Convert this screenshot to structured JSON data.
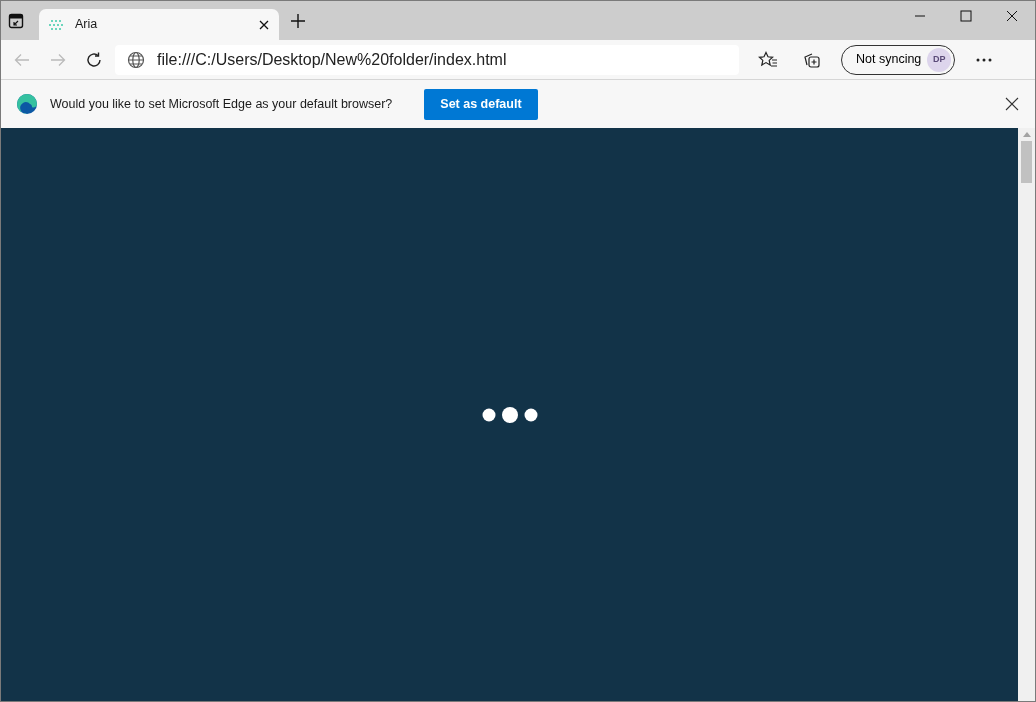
{
  "tabs": [
    {
      "title": "Aria",
      "selected": true
    }
  ],
  "address_bar": {
    "url": "file:///C:/Users/Desktop/New%20folder/index.html"
  },
  "profile": {
    "label": "Not syncing",
    "initials": "DP"
  },
  "infobar": {
    "message": "Would you like to set Microsoft Edge as your default browser?",
    "button": "Set as default"
  }
}
